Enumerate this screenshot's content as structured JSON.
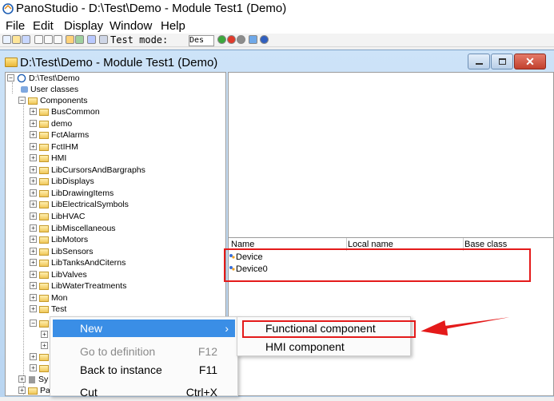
{
  "app": {
    "title": "PanoStudio - D:\\Test\\Demo - Module Test1 (Demo)"
  },
  "menubar": [
    "File",
    "Edit",
    "Display",
    "Window",
    "Help"
  ],
  "toolbar": {
    "test_mode_label": "Test mode:",
    "test_mode_value": "Des"
  },
  "child_window": {
    "title": "D:\\Test\\Demo - Module Test1 (Demo)",
    "close_glyph": "✕"
  },
  "tree": {
    "root": "D:\\Test\\Demo",
    "user_classes": "User classes",
    "components": "Components",
    "component_children": [
      "BusCommon",
      "demo",
      "FctAlarms",
      "FctIHM",
      "HMI",
      "LibCursorsAndBargraphs",
      "LibDisplays",
      "LibDrawingItems",
      "LibElectricalSymbols",
      "LibHVAC",
      "LibMiscellaneous",
      "LibMotors",
      "LibSensors",
      "LibTanksAndCiterns",
      "LibValves",
      "LibWaterTreatments",
      "Mon",
      "Test"
    ],
    "partial_sy": "Sy",
    "partial_pa": "Pa"
  },
  "list": {
    "columns": [
      "Name",
      "Local name",
      "Base class"
    ],
    "rows": [
      "Device",
      "Device0"
    ]
  },
  "context_menu": {
    "items": [
      {
        "label": "New",
        "shortcut": "",
        "enabled": true,
        "has_submenu": true,
        "submenu_arrow": "›"
      },
      {
        "label": "Go to definition",
        "shortcut": "F12",
        "enabled": false
      },
      {
        "label": "Back to instance",
        "shortcut": "F11",
        "enabled": true
      },
      {
        "label": "Cut",
        "shortcut": "Ctrl+X",
        "enabled": true
      }
    ]
  },
  "submenu": {
    "items": [
      "Functional component",
      "HMI component"
    ]
  },
  "colors": {
    "highlight": "#3a8ee6",
    "annotation_red": "#e41a1a"
  }
}
